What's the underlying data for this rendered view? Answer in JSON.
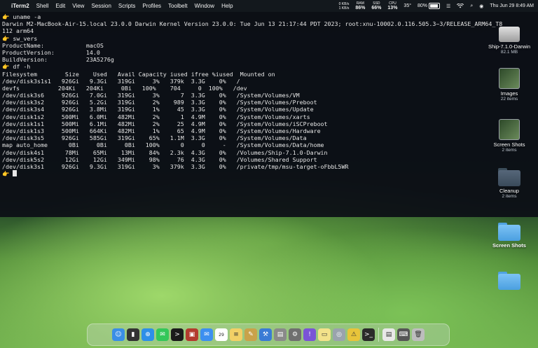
{
  "menubar": {
    "app_name": "iTerm2",
    "menus": [
      "Shell",
      "Edit",
      "View",
      "Session",
      "Scripts",
      "Profiles",
      "Toolbelt",
      "Window",
      "Help"
    ],
    "net": {
      "top": "0 KB/s",
      "bottom": "1 KB/s"
    },
    "ram": {
      "label": "RAM",
      "value": "86%"
    },
    "ssd": {
      "label": "SSD",
      "value": "66%"
    },
    "cpu": {
      "label": "CPU",
      "value": "13%"
    },
    "temp": "35°",
    "battery": "80%",
    "datetime": "Thu Jun 29  8:49 AM",
    "colors": {
      "accent": "#f5b400"
    }
  },
  "terminal": {
    "lines": [
      {
        "prompt": true,
        "text": "uname -a"
      },
      {
        "prompt": false,
        "text": "Darwin M2-MacBook-Air-15.local 23.0.0 Darwin Kernel Version 23.0.0: Tue Jun 13 21:17:44 PDT 2023; root:xnu-10002.0.116.505.3~3/RELEASE_ARM64_T8"
      },
      {
        "prompt": false,
        "text": "112 arm64"
      },
      {
        "prompt": true,
        "text": "sw_vers"
      },
      {
        "prompt": false,
        "text": "ProductName:            macOS"
      },
      {
        "prompt": false,
        "text": "ProductVersion:         14.0"
      },
      {
        "prompt": false,
        "text": "BuildVersion:           23A5276g"
      },
      {
        "prompt": true,
        "text": "df -h"
      },
      {
        "prompt": false,
        "text": "Filesystem        Size    Used   Avail Capacity iused ifree %iused  Mounted on"
      },
      {
        "prompt": false,
        "text": "/dev/disk3s1s1   926Gi   9.3Gi   319Gi     3%   379k  3.3G    0%   /"
      },
      {
        "prompt": false,
        "text": "devfs           204Ki   204Ki     0Bi   100%    704     0  100%   /dev"
      },
      {
        "prompt": false,
        "text": "/dev/disk3s6     926Gi   7.0Gi   319Gi     3%      7  3.3G    0%   /System/Volumes/VM"
      },
      {
        "prompt": false,
        "text": "/dev/disk3s2     926Gi   5.2Gi   319Gi     2%    989  3.3G    0%   /System/Volumes/Preboot"
      },
      {
        "prompt": false,
        "text": "/dev/disk3s4     926Gi   3.8Mi   319Gi     1%     45  3.3G    0%   /System/Volumes/Update"
      },
      {
        "prompt": false,
        "text": "/dev/disk1s2     500Mi   6.0Mi   482Mi     2%      1  4.9M    0%   /System/Volumes/xarts"
      },
      {
        "prompt": false,
        "text": "/dev/disk1s1     500Mi   6.1Mi   482Mi     2%     25  4.9M    0%   /System/Volumes/iSCPreboot"
      },
      {
        "prompt": false,
        "text": "/dev/disk1s3     500Mi   664Ki   482Mi     1%     65  4.9M    0%   /System/Volumes/Hardware"
      },
      {
        "prompt": false,
        "text": "/dev/disk3s5     926Gi   585Gi   319Gi    65%   1.1M  3.3G    0%   /System/Volumes/Data"
      },
      {
        "prompt": false,
        "text": "map auto_home      0Bi     0Bi     0Bi   100%      0     0     -   /System/Volumes/Data/home"
      },
      {
        "prompt": false,
        "text": "/dev/disk4s1      78Mi    65Mi    13Mi    84%   2.3k  4.3G    0%   /Volumes/Ship-7.1.0-Darwin"
      },
      {
        "prompt": false,
        "text": "/dev/disk5s2      12Gi    12Gi   349Mi    98%     76  4.3G    0%   /Volumes/Shared Support"
      },
      {
        "prompt": false,
        "text": "/dev/disk3s1     926Gi   9.3Gi   319Gi     3%   379k  3.3G    0%   /private/tmp/msu-target-oFbbL5WR"
      }
    ]
  },
  "desktop": {
    "ship": {
      "label": "Ship-7.1.0-Darwin",
      "sub": "82.1 MB"
    },
    "images": {
      "label": "Images",
      "sub": "22 items"
    },
    "screenshots_top": {
      "label": "Screen Shots",
      "sub": "2 items"
    },
    "cleanup": {
      "label": "Cleanup",
      "sub": "2 items"
    },
    "screenshots_bottom": {
      "label": "Screen Shots"
    }
  },
  "dock": {
    "apps": [
      {
        "name": "finder-icon",
        "glyph": "☺",
        "color": "#3a8ee6"
      },
      {
        "name": "terminal-small-icon",
        "glyph": "▮",
        "color": "#333333"
      },
      {
        "name": "safari-icon",
        "glyph": "⊕",
        "color": "#2d8fe8"
      },
      {
        "name": "messages-icon",
        "glyph": "✉",
        "color": "#34c759"
      },
      {
        "name": "iterm-icon",
        "glyph": ">",
        "color": "#1b1b1b"
      },
      {
        "name": "photo-booth-icon",
        "glyph": "▣",
        "color": "#b33b2e"
      },
      {
        "name": "mail-icon",
        "glyph": "✉",
        "color": "#3d8ff0"
      },
      {
        "name": "calendar-icon",
        "glyph": "29",
        "color": "#ffffff"
      },
      {
        "name": "notes-icon",
        "glyph": "≡",
        "color": "#f2d066"
      },
      {
        "name": "scripts-icon",
        "glyph": "✎",
        "color": "#c9a24a"
      },
      {
        "name": "xcode-icon",
        "glyph": "⚒",
        "color": "#3a7bd5"
      },
      {
        "name": "preview-icon",
        "glyph": "▤",
        "color": "#8a8a8a"
      },
      {
        "name": "system-settings-icon",
        "glyph": "⚙",
        "color": "#6f6f6f"
      },
      {
        "name": "feedback-icon",
        "glyph": "!",
        "color": "#7a54d6"
      },
      {
        "name": "stickies-icon",
        "glyph": "▭",
        "color": "#f3e28a"
      },
      {
        "name": "disk-utility-icon",
        "glyph": "◎",
        "color": "#9aa3ad"
      },
      {
        "name": "console-icon",
        "glyph": "⚠",
        "color": "#e8c43a"
      },
      {
        "name": "terminal-icon",
        "glyph": ">_",
        "color": "#2a2a2a"
      },
      {
        "name": "document-icon",
        "glyph": "▤",
        "color": "#e8e8e8"
      },
      {
        "name": "keyboard-icon",
        "glyph": "⌨",
        "color": "#555555"
      },
      {
        "name": "trash-icon",
        "glyph": "🗑",
        "color": "#bdbdbd"
      }
    ]
  }
}
